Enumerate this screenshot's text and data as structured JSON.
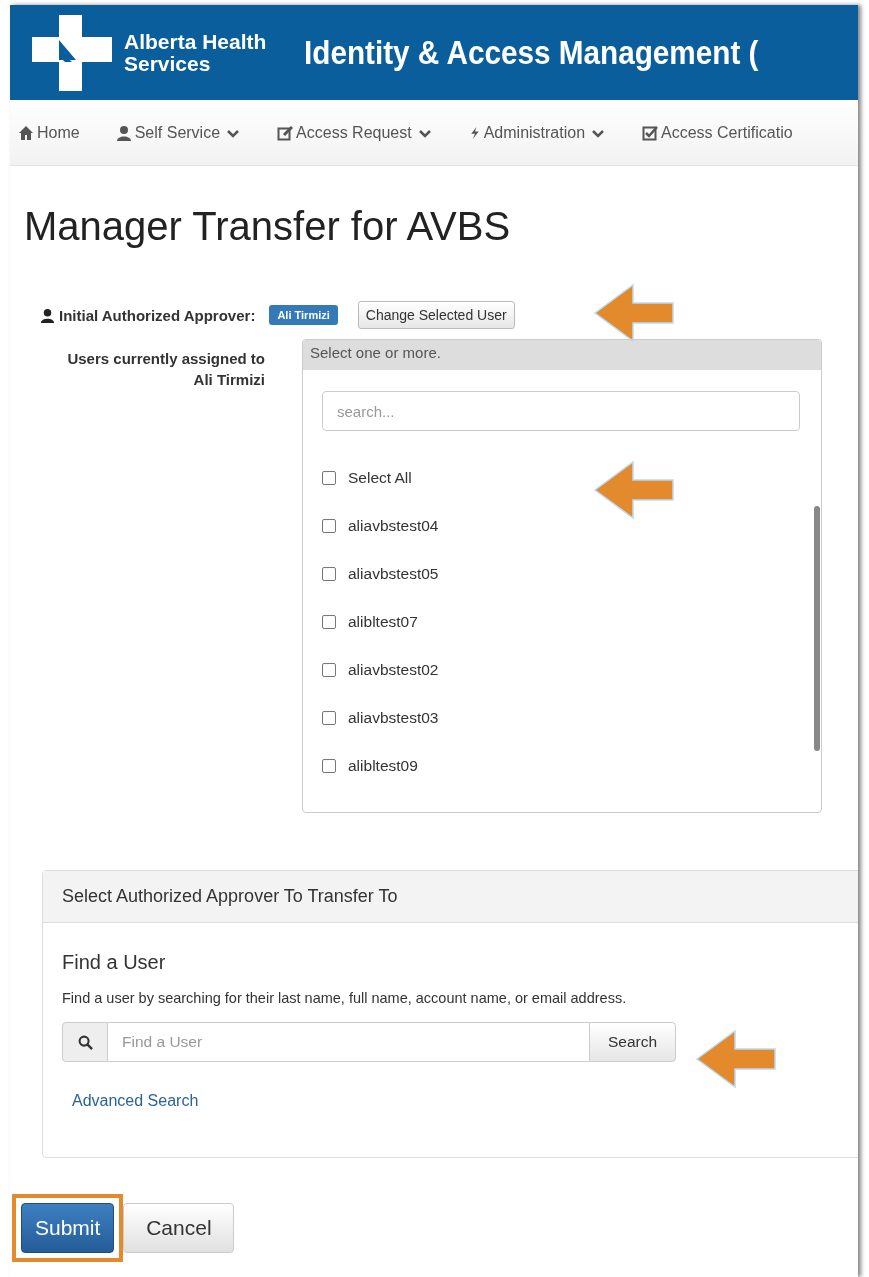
{
  "header": {
    "logo_line1": "Alberta Health",
    "logo_line2": "Services",
    "title": "Identity & Access Management ("
  },
  "nav": [
    {
      "label": "Home",
      "kind": "home",
      "dropdown": false
    },
    {
      "label": "Self Service",
      "kind": "user",
      "dropdown": true
    },
    {
      "label": "Access Request",
      "kind": "edit",
      "dropdown": true
    },
    {
      "label": "Administration",
      "kind": "bolt",
      "dropdown": true
    },
    {
      "label": "Access Certificatio",
      "kind": "check",
      "dropdown": false
    }
  ],
  "page_title": "Manager Transfer for AVBS",
  "approver": {
    "label": "Initial Authorized Approver:",
    "badge": "Ali Tirmizi",
    "button": "Change Selected User"
  },
  "assigned": {
    "label_line1": "Users currently assigned to",
    "label_line2": "Ali Tirmizi",
    "header": "Select one or more.",
    "search_placeholder": "search...",
    "select_all": {
      "label": "Select All",
      "checked": false
    },
    "users": [
      {
        "label": "aliavbstest04",
        "checked": false
      },
      {
        "label": "aliavbstest05",
        "checked": false
      },
      {
        "label": "alibltest07",
        "checked": false
      },
      {
        "label": "aliavbstest02",
        "checked": false
      },
      {
        "label": "aliavbstest03",
        "checked": false
      },
      {
        "label": "alibltest09",
        "checked": false
      }
    ]
  },
  "transfer_panel": {
    "header": "Select Authorized Approver To Transfer To",
    "heading": "Find a User",
    "description": "Find a user by searching for their last name, full name, account name, or email address.",
    "placeholder": "Find a User",
    "search_button": "Search",
    "link": "Advanced Search"
  },
  "buttons": [
    {
      "label": "Submit",
      "kind": "primary",
      "highlighted": true
    },
    {
      "label": "Cancel",
      "kind": "default",
      "highlighted": false
    }
  ]
}
